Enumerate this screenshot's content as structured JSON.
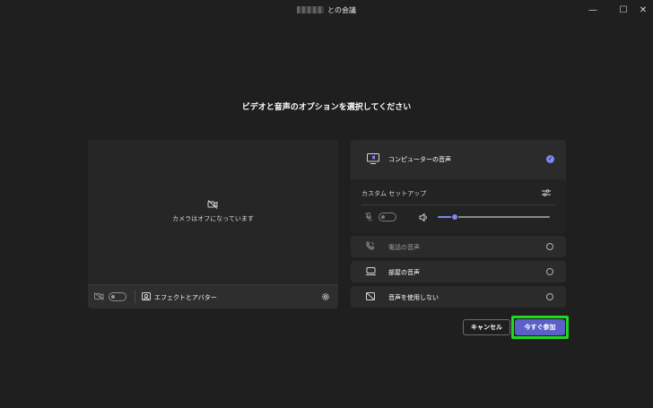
{
  "window": {
    "title_suffix": "との会議",
    "minimize_glyph": "—",
    "maximize_glyph": "☐",
    "close_glyph": "✕"
  },
  "heading": "ビデオと音声のオプションを選択してください",
  "preview": {
    "camera_off_text": "カメラはオフになっています",
    "effects_label": "エフェクトとアバター",
    "camera_toggle_on": false
  },
  "audio_options": {
    "computer_audio": {
      "label": "コンピューターの音声",
      "selected": true
    },
    "custom_setup": {
      "label": "カスタム セットアップ"
    },
    "mic_toggle_on": false,
    "speaker_volume_percent": 15,
    "phone_audio": {
      "label": "電話の音声",
      "selected": false
    },
    "room_audio": {
      "label": "部屋の音声",
      "selected": false
    },
    "no_audio": {
      "label": "音声を使用しない",
      "selected": false
    }
  },
  "buttons": {
    "cancel": "キャンセル",
    "join_now": "今すぐ参加"
  },
  "colors": {
    "background": "#1f1f1f",
    "accent": "#5b5fc7",
    "check": "#7f85f5",
    "highlight_border": "#1ed91e"
  }
}
